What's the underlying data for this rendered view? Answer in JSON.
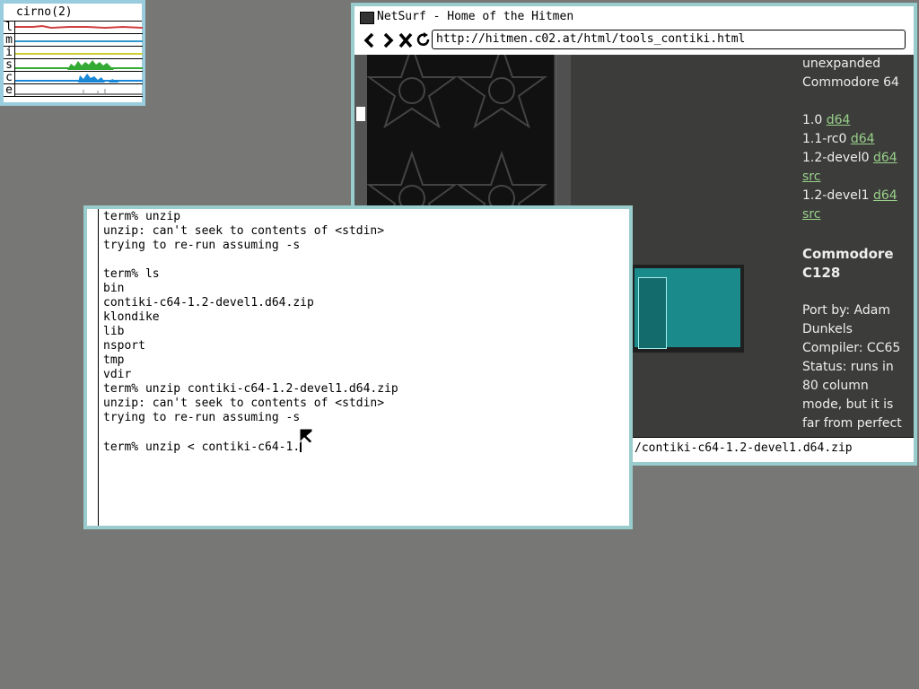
{
  "stats": {
    "title": "cirno(2)",
    "rows": [
      {
        "letter": "l",
        "color": "#d04040"
      },
      {
        "letter": "m",
        "color": "#3399cc"
      },
      {
        "letter": "i",
        "color": "#cccc33"
      },
      {
        "letter": "s",
        "color": "#33aa33"
      },
      {
        "letter": "c",
        "color": "#1a88d8"
      },
      {
        "letter": "e",
        "color": "#888888"
      }
    ]
  },
  "browser": {
    "title": "NetSurf - Home of the Hitmen",
    "url": "http://hitmen.c02.at/html/tools_contiki.html",
    "status": "/contiki-c64-1.2-devel1.d64.zip",
    "sidebar": {
      "unexpanded": "unexpanded",
      "commodore64": "Commodore 64",
      "releases": [
        {
          "ver": "1.0",
          "links": [
            "d64"
          ]
        },
        {
          "ver": "1.1-rc0",
          "links": [
            "d64"
          ]
        },
        {
          "ver": "1.2-devel0",
          "links": [
            "d64",
            "src"
          ]
        },
        {
          "ver": "1.2-devel1",
          "links": [
            "d64",
            "src"
          ]
        }
      ],
      "c128_heading_1": "Commodore",
      "c128_heading_2": "C128",
      "port_by_1": "Port by: Adam",
      "port_by_2": "Dunkels",
      "compiler": "Compiler: CC65",
      "status_1": "Status: runs in",
      "status_2": "80 column",
      "status_3": "mode, but it is",
      "status_4": "far from perfect"
    }
  },
  "terminal": {
    "lines": [
      "term% unzip",
      "unzip: can't seek to contents of <stdin>",
      "trying to re-run assuming -s",
      "",
      "term% ls",
      "bin",
      "contiki-c64-1.2-devel1.d64.zip",
      "klondike",
      "lib",
      "nsport",
      "tmp",
      "vdir",
      "term% unzip contiki-c64-1.2-devel1.d64.zip",
      "unzip: can't seek to contents of <stdin>",
      "trying to re-run assuming -s",
      "",
      "term% unzip < contiki-c64-1."
    ]
  }
}
